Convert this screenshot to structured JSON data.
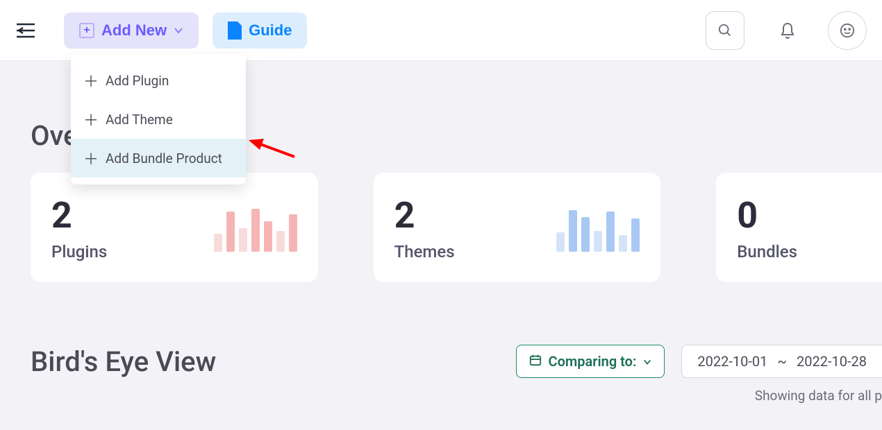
{
  "topbar": {
    "add_new_label": "Add New",
    "guide_label": "Guide"
  },
  "dropdown": {
    "items": [
      {
        "label": "Add Plugin"
      },
      {
        "label": "Add Theme"
      },
      {
        "label": "Add Bundle Product"
      }
    ]
  },
  "overview": {
    "heading": "Overview",
    "cards": [
      {
        "value": "2",
        "label": "Plugins"
      },
      {
        "value": "2",
        "label": "Themes"
      },
      {
        "value": "0",
        "label": "Bundles"
      }
    ]
  },
  "birds_eye": {
    "heading": "Bird's Eye View",
    "compare_label": "Comparing to:",
    "date_from": "2022-10-01",
    "date_sep": "~",
    "date_to": "2022-10-28",
    "subtitle": "Showing data for all p"
  }
}
